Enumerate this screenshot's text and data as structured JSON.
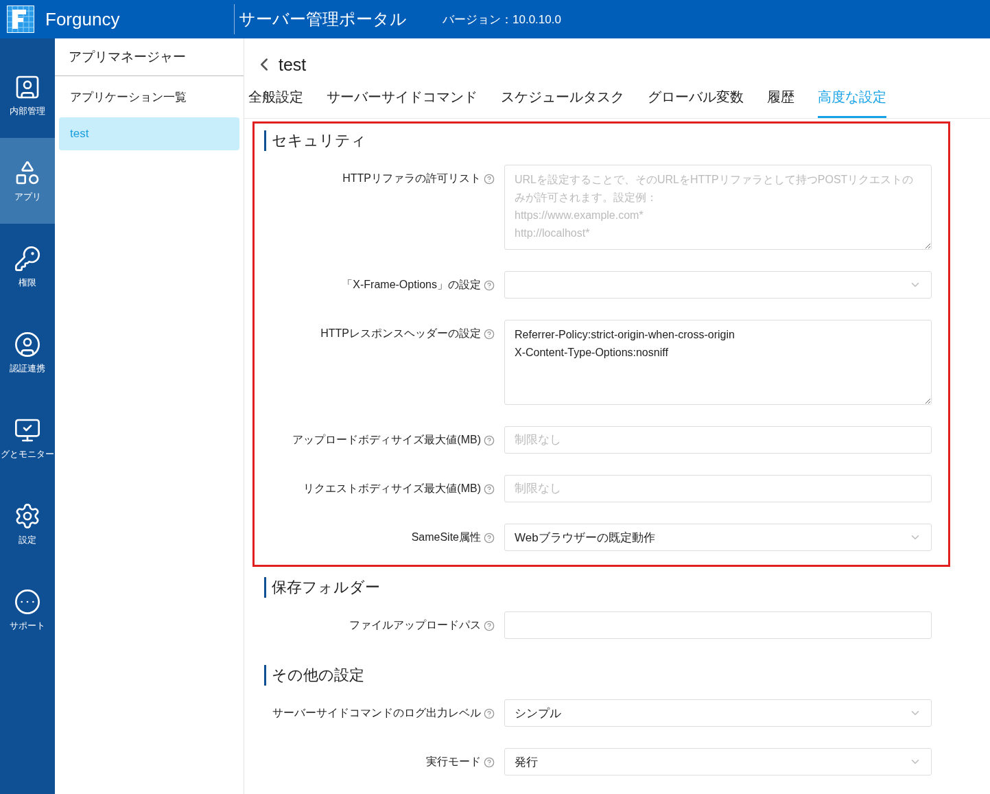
{
  "header": {
    "brand": "Forguncy",
    "title": "サーバー管理ポータル",
    "version": "バージョン：10.0.10.0"
  },
  "nav": [
    {
      "label": "内部管理",
      "selected": false
    },
    {
      "label": "アプリ",
      "selected": true
    },
    {
      "label": "権限",
      "selected": false
    },
    {
      "label": "認証連携",
      "selected": false
    },
    {
      "label": "グとモニター",
      "selected": false
    },
    {
      "label": "設定",
      "selected": false
    },
    {
      "label": "サポート",
      "selected": false
    }
  ],
  "sidebar": {
    "title": "アプリマネージャー",
    "items": [
      {
        "label": "アプリケーション一覧",
        "selected": false
      },
      {
        "label": "test",
        "selected": true
      }
    ]
  },
  "page": {
    "back_title": "test",
    "tabs": [
      {
        "label": "全般設定",
        "selected": false
      },
      {
        "label": "サーバーサイドコマンド",
        "selected": false
      },
      {
        "label": "スケジュールタスク",
        "selected": false
      },
      {
        "label": "グローバル変数",
        "selected": false
      },
      {
        "label": "履歴",
        "selected": false
      },
      {
        "label": "高度な設定",
        "selected": true
      }
    ]
  },
  "sections": [
    {
      "title": "セキュリティ",
      "highlighted": true,
      "fields": [
        {
          "kind": "textarea",
          "label": "HTTPリファラの許可リスト",
          "placeholder": "URLを設定することで、そのURLをHTTPリファラとして持つPOSTリクエストのみが許可されます。設定例：\nhttps://www.example.com*\nhttp://localhost*"
        },
        {
          "kind": "select",
          "label": "「X-Frame-Options」の設定"
        },
        {
          "kind": "textarea",
          "label": "HTTPレスポンスヘッダーの設定",
          "value": "Referrer-Policy:strict-origin-when-cross-origin\nX-Content-Type-Options:nosniff"
        },
        {
          "kind": "input",
          "label": "アップロードボディサイズ最大値(MB)",
          "placeholder": "制限なし"
        },
        {
          "kind": "input",
          "label": "リクエストボディサイズ最大値(MB)",
          "placeholder": "制限なし"
        },
        {
          "kind": "select",
          "label": "SameSite属性",
          "value": "Webブラウザーの既定動作"
        }
      ]
    },
    {
      "title": "保存フォルダー",
      "highlighted": false,
      "fields": [
        {
          "kind": "input",
          "label": "ファイルアップロードパス"
        }
      ]
    },
    {
      "title": "その他の設定",
      "highlighted": false,
      "fields": [
        {
          "kind": "select",
          "label": "サーバーサイドコマンドのログ出力レベル",
          "value": "シンプル"
        },
        {
          "kind": "select",
          "label": "実行モード",
          "value": "発行"
        }
      ]
    }
  ]
}
